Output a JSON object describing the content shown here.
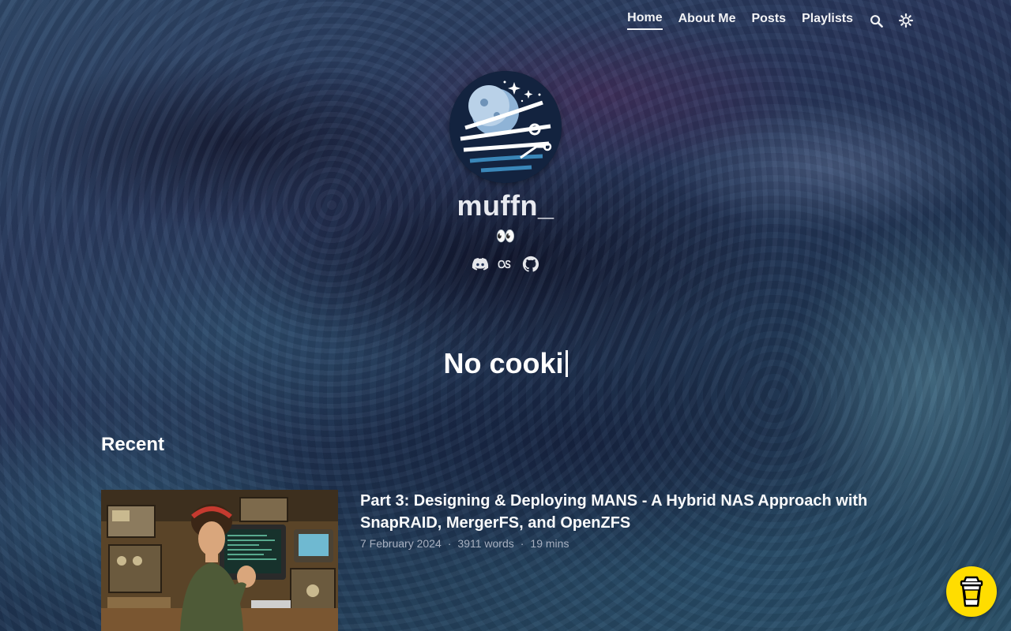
{
  "nav": {
    "items": [
      {
        "label": "Home",
        "active": true
      },
      {
        "label": "About Me",
        "active": false
      },
      {
        "label": "Posts",
        "active": false
      },
      {
        "label": "Playlists",
        "active": false
      }
    ],
    "search_icon": "search-icon",
    "theme_icon": "sun-icon"
  },
  "profile": {
    "username": "muffn_",
    "tagline": "👀",
    "socials": [
      "discord-icon",
      "lastfm-icon",
      "github-icon"
    ]
  },
  "hero": {
    "typed_text": "No cooki"
  },
  "recent": {
    "heading": "Recent",
    "posts": [
      {
        "title": "Part 3: Designing & Deploying MANS - A Hybrid NAS Approach with SnapRAID, MergerFS, and OpenZFS",
        "date": "7 February 2024",
        "words": "3911 words",
        "read_time": "19 mins"
      }
    ]
  },
  "colors": {
    "coffee_button": "#ffdd00",
    "text": "#e5e7eb",
    "meta": "#a7b0c0"
  }
}
